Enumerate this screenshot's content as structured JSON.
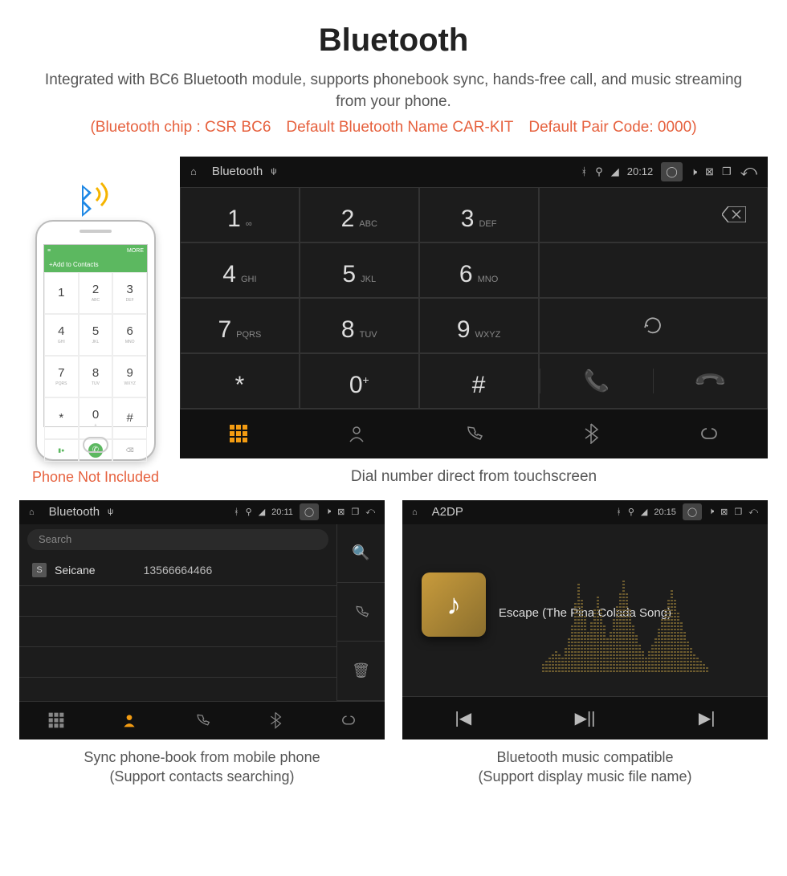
{
  "header": {
    "title": "Bluetooth",
    "desc": "Integrated with BC6 Bluetooth module, supports phonebook sync, hands-free call, and music streaming from your phone.",
    "spec": "(Bluetooth chip : CSR BC6 Default Bluetooth Name CAR-KIT Default Pair Code: 0000)"
  },
  "phone": {
    "addContacts": "Add to Contacts",
    "moreLabel": "MORE",
    "keys": [
      {
        "n": "1",
        "l": ""
      },
      {
        "n": "2",
        "l": "ABC"
      },
      {
        "n": "3",
        "l": "DEF"
      },
      {
        "n": "4",
        "l": "GHI"
      },
      {
        "n": "5",
        "l": "JKL"
      },
      {
        "n": "6",
        "l": "MNO"
      },
      {
        "n": "7",
        "l": "PQRS"
      },
      {
        "n": "8",
        "l": "TUV"
      },
      {
        "n": "9",
        "l": "WXYZ"
      },
      {
        "n": "*",
        "l": ""
      },
      {
        "n": "0",
        "l": "+"
      },
      {
        "n": "#",
        "l": ""
      }
    ],
    "caption": "Phone Not Included"
  },
  "hu": {
    "statusbar": {
      "title": "Bluetooth",
      "time": "20:12"
    },
    "keys": [
      {
        "n": "1",
        "l": "∞"
      },
      {
        "n": "2",
        "l": "ABC"
      },
      {
        "n": "3",
        "l": "DEF"
      },
      {
        "n": "4",
        "l": "GHI"
      },
      {
        "n": "5",
        "l": "JKL"
      },
      {
        "n": "6",
        "l": "MNO"
      },
      {
        "n": "7",
        "l": "PQRS"
      },
      {
        "n": "8",
        "l": "TUV"
      },
      {
        "n": "9",
        "l": "WXYZ"
      },
      {
        "n": "*",
        "l": ""
      },
      {
        "n": "0",
        "l": "+",
        "sup": true
      },
      {
        "n": "#",
        "l": ""
      }
    ],
    "caption": "Dial number direct from touchscreen"
  },
  "pb": {
    "statusbar": {
      "title": "Bluetooth",
      "time": "20:11"
    },
    "searchPlaceholder": "Search",
    "contact": {
      "initial": "S",
      "name": "Seicane",
      "number": "13566664466"
    },
    "caption_l1": "Sync phone-book from mobile phone",
    "caption_l2": "(Support contacts searching)"
  },
  "music": {
    "statusbar": {
      "title": "A2DP",
      "time": "20:15"
    },
    "song": "Escape (The Pina Colada Song)",
    "caption_l1": "Bluetooth music compatible",
    "caption_l2": "(Support display music file name)"
  }
}
